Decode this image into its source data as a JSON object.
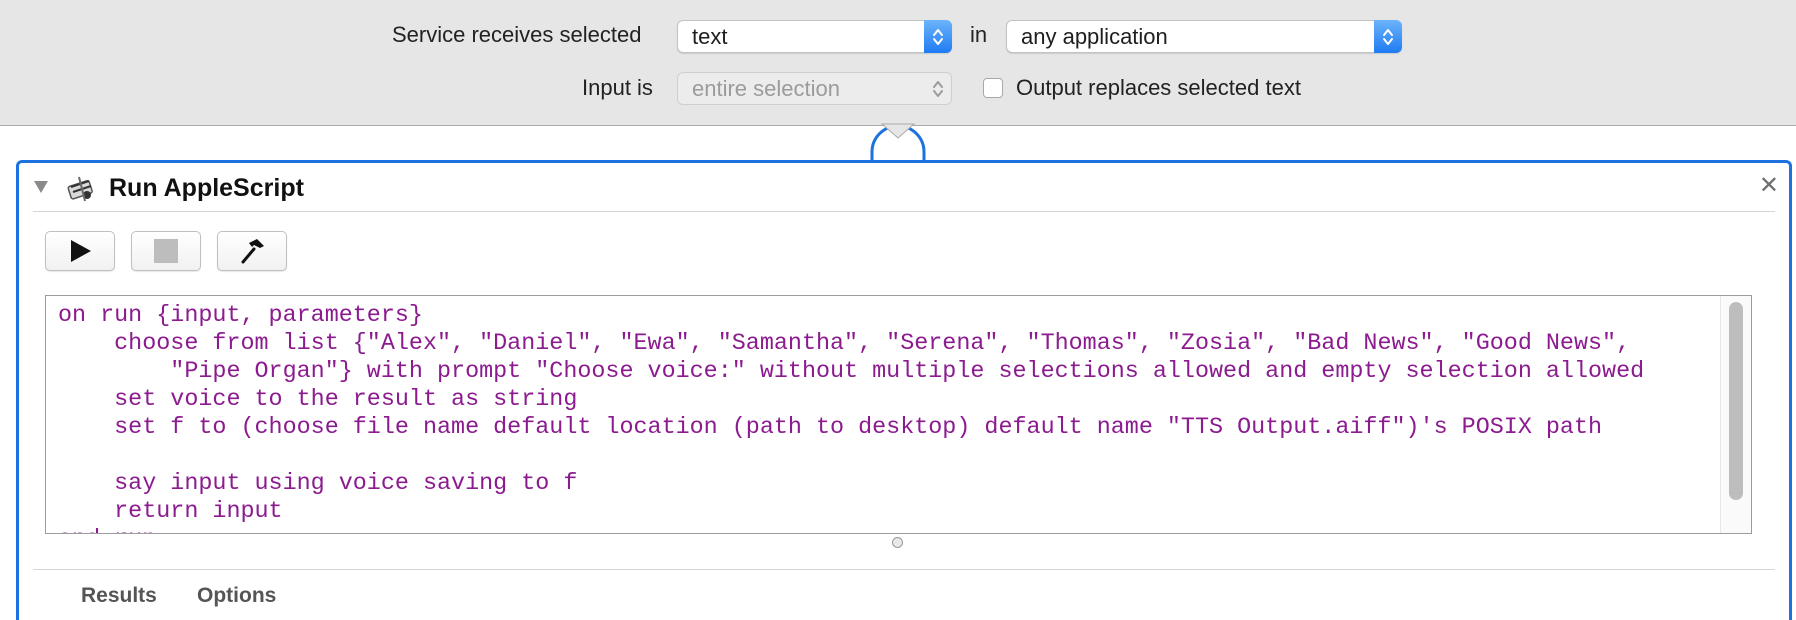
{
  "service": {
    "receives_label": "Service receives selected",
    "receives_value": "text",
    "in_label": "in",
    "application_value": "any application",
    "input_is_label": "Input is",
    "input_is_value": "entire selection",
    "output_replaces_label": "Output replaces selected text",
    "output_replaces_checked": false
  },
  "action": {
    "title": "Run AppleScript",
    "close_glyph": "✕",
    "icon": "applescript-script-icon",
    "toolbar": {
      "run_icon": "play-icon",
      "stop_icon": "stop-icon",
      "compile_icon": "hammer-icon"
    },
    "code_lines": [
      "on run {input, parameters}",
      "    choose from list {\"Alex\", \"Daniel\", \"Ewa\", \"Samantha\", \"Serena\", \"Thomas\", \"Zosia\", \"Bad News\", \"Good News\",",
      "        \"Pipe Organ\"} with prompt \"Choose voice:\" without multiple selections allowed and empty selection allowed",
      "    set voice to the result as string",
      "    set f to (choose file name default location (path to desktop) default name \"TTS Output.aiff\")'s POSIX path",
      "",
      "    say input using voice saving to f",
      "    return input",
      "end run"
    ],
    "tabs": [
      "Results",
      "Options"
    ]
  },
  "colors": {
    "accent": "#1d72e0",
    "code_text": "#8b1b8f",
    "popup_arrows": "#1f7cf4"
  }
}
